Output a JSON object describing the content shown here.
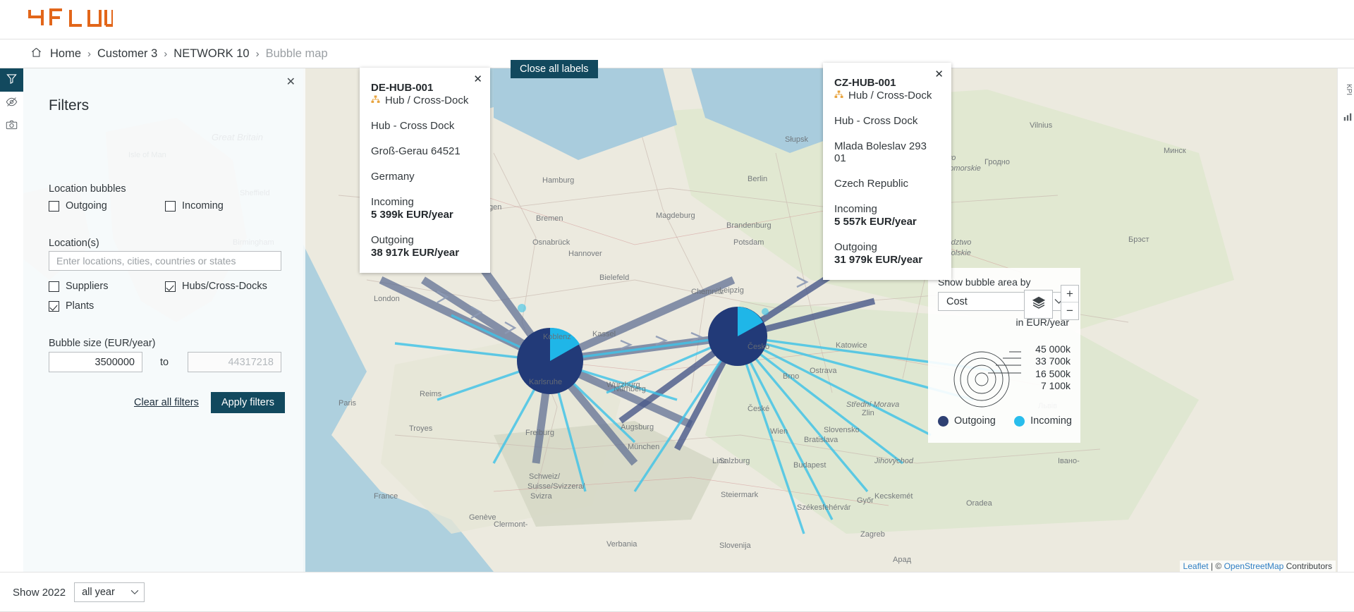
{
  "app": {
    "logo_text": "4FLOW",
    "brand_color": "#e2661a",
    "accent_dark": "#12495e"
  },
  "breadcrumb": {
    "home_icon": "home-icon",
    "items": [
      "Home",
      "Customer 3",
      "NETWORK 10",
      "Bubble map"
    ],
    "separator": "›"
  },
  "view_select": {
    "value": "Bubble map",
    "chevron": "chevron-down-icon"
  },
  "filters": {
    "title": "Filters",
    "close_icon": "close-icon",
    "location_bubbles_label": "Location bubbles",
    "outgoing": {
      "label": "Outgoing",
      "checked": false
    },
    "incoming": {
      "label": "Incoming",
      "checked": false
    },
    "locations_label": "Location(s)",
    "locations_input": {
      "value": "",
      "placeholder": "Enter locations, cities, countries or states"
    },
    "suppliers": {
      "label": "Suppliers",
      "checked": false
    },
    "hubs": {
      "label": "Hubs/Cross-Docks",
      "checked": true
    },
    "plants": {
      "label": "Plants",
      "checked": true
    },
    "bubble_size_label": "Bubble size (EUR/year)",
    "size_min": {
      "value": "3500000",
      "placeholder": ""
    },
    "size_to": "to",
    "size_max": {
      "value": "",
      "placeholder": "44317218"
    },
    "clear_label": "Clear all filters",
    "apply_label": "Apply filters"
  },
  "map_toolbar": {
    "close_all_labels": "Close all labels"
  },
  "popups": [
    {
      "code": "DE-HUB-001",
      "type_icon": "hub-cross-dock-icon",
      "type": "Hub / Cross-Dock",
      "line1": "Hub - Cross Dock",
      "line2": "Groß-Gerau 64521",
      "line3": "Germany",
      "incoming_label": "Incoming",
      "incoming_value": "5 399k EUR/year",
      "outgoing_label": "Outgoing",
      "outgoing_value": "38 917k EUR/year",
      "close_icon": "close-icon"
    },
    {
      "code": "CZ-HUB-001",
      "type_icon": "hub-cross-dock-icon",
      "type": "Hub / Cross-Dock",
      "line1": "Hub - Cross Dock",
      "line2": "Mlada Boleslav 293 01",
      "line3": "Czech Republic",
      "incoming_label": "Incoming",
      "incoming_value": "5 557k EUR/year",
      "outgoing_label": "Outgoing",
      "outgoing_value": "31 979k EUR/year",
      "close_icon": "close-icon"
    }
  ],
  "legend": {
    "title": "Show bubble area by",
    "metric": "Cost",
    "chevron": "chevron-down-icon",
    "unit": "in EUR/year",
    "sizes": [
      "45 000k",
      "33 700k",
      "16 500k",
      "7 100k"
    ],
    "key": [
      {
        "label": "Outgoing",
        "color": "#2e4073"
      },
      {
        "label": "Incoming",
        "color": "#29bdec"
      }
    ]
  },
  "map_controls": {
    "zoom_in": "+",
    "zoom_out": "−",
    "layers_icon": "layers-icon"
  },
  "attribution": {
    "leaflet": "Leaflet",
    "sep": "| ©",
    "osm": "OpenStreetMap",
    "suffix": "Contributors"
  },
  "bottom": {
    "show_label": "Show 2022",
    "year_value": "all year",
    "chevron": "chevron-down-icon"
  },
  "rail": {
    "filter_icon": "filter-icon",
    "visibility_icon": "eye-off-icon",
    "camera_icon": "camera-icon",
    "kpi_label": "KPI"
  }
}
